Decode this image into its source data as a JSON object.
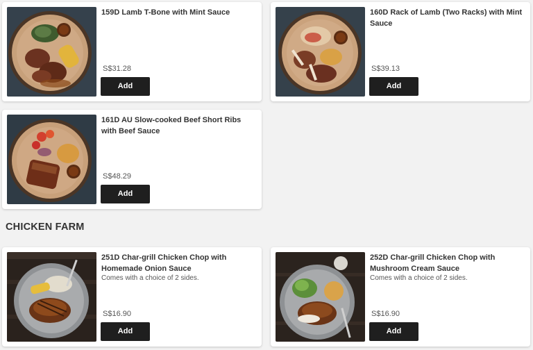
{
  "sections": [
    {
      "heading": "",
      "items": [
        {
          "title": "159D Lamb T-Bone with Mint Sauce",
          "description": "",
          "price": "S$31.28",
          "button": "Add"
        },
        {
          "title": "160D Rack of Lamb (Two Racks) with Mint Sauce",
          "description": "",
          "price": "S$39.13",
          "button": "Add"
        },
        {
          "title": "161D AU Slow-cooked Beef Short Ribs with Beef Sauce",
          "description": "",
          "price": "S$48.29",
          "button": "Add"
        }
      ]
    },
    {
      "heading": "CHICKEN FARM",
      "items": [
        {
          "title": "251D Char-grill Chicken Chop with Homemade Onion Sauce",
          "description": "Comes with a choice of 2 sides.",
          "price": "S$16.90",
          "button": "Add"
        },
        {
          "title": "252D Char-grill Chicken Chop with Mushroom Cream Sauce",
          "description": "Comes with a choice of 2 sides.",
          "price": "S$16.90",
          "button": "Add"
        }
      ]
    }
  ]
}
